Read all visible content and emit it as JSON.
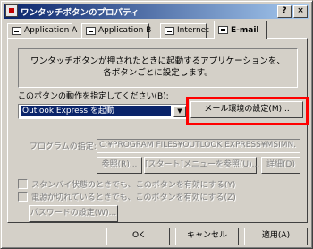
{
  "window": {
    "title": "ワンタッチボタンのプロパティ"
  },
  "titlebar": {
    "help_glyph": "?",
    "close_glyph": "×"
  },
  "tabs": [
    {
      "label": "Application A"
    },
    {
      "label": "Application B"
    },
    {
      "label": "Internet"
    },
    {
      "label": "E-mail"
    }
  ],
  "panel": {
    "description_line1": "ワンタッチボタンが押されたときに起動するアプリケーションを、",
    "description_line2": "各ボタンごとに設定します。",
    "action_label": "このボタンの動作を指定してください(B):",
    "action_value": "Outlook Express を起動",
    "mail_settings_button": "メール環境の設定(M)...",
    "program_label": "プログラムの指定:",
    "program_path": "C:¥PROGRAM FILES¥OUTLOOK EXPRESS¥MSIMN.",
    "browse_button": "参照(R)...",
    "start_menu_button": "[スタート]メニューを参照(U)...",
    "details_button": "詳細(D)",
    "standby_checkbox": "スタンバイ状態のときでも、このボタンを有効にする(Y)",
    "poweroff_checkbox": "電源が切れているときでも、このボタンを有効にする(Z)",
    "password_button": "パスワードの設定(W)..."
  },
  "footer": {
    "ok": "OK",
    "cancel": "キャンセル",
    "apply": "適用(A)"
  }
}
